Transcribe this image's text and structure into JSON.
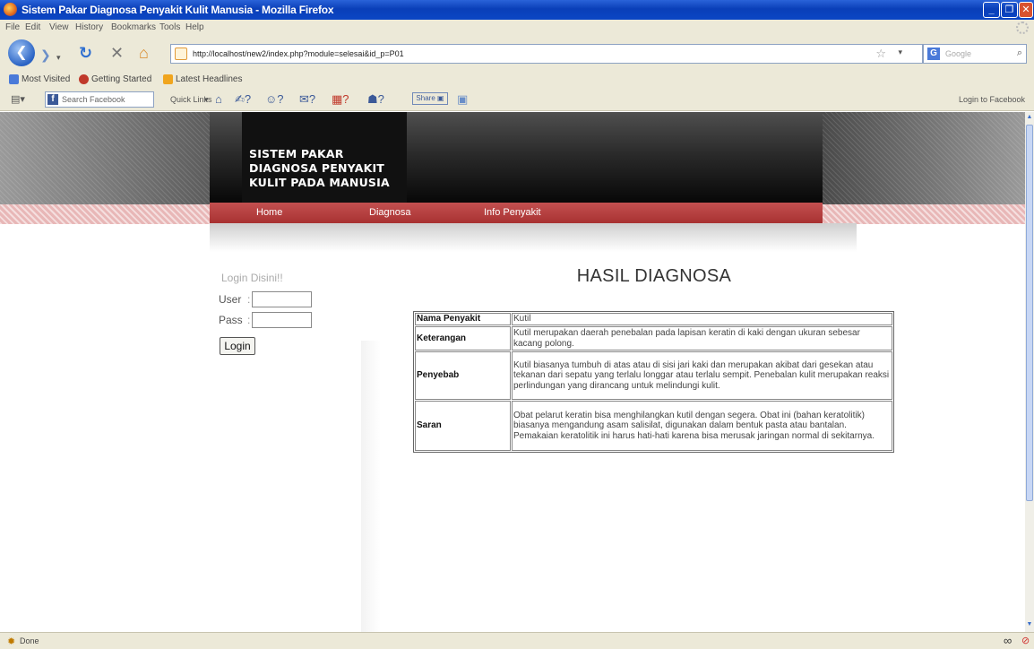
{
  "window": {
    "title": "Sistem Pakar Diagnosa Penyakit Kulit Manusia - Mozilla Firefox"
  },
  "menubar": {
    "items": [
      "File",
      "Edit",
      "View",
      "History",
      "Bookmarks",
      "Tools",
      "Help"
    ]
  },
  "navbar": {
    "url": "http://localhost/new2/index.php?module=selesai&id_p=P01",
    "search_placeholder": "Google"
  },
  "bookmarks": {
    "items": [
      "Most Visited",
      "Getting Started",
      "Latest Headlines"
    ]
  },
  "fbbar": {
    "search_placeholder": "Search Facebook",
    "quick_links": "Quick Links",
    "share_label": "Share",
    "login_link": "Login to Facebook"
  },
  "site": {
    "logo_lines": [
      "SISTEM PAKAR",
      "DIAGNOSA PENYAKIT",
      "KULIT PADA MANUSIA"
    ],
    "nav": [
      "Home",
      "Diagnosa",
      "Info Penyakit"
    ]
  },
  "login": {
    "heading": "Login Disini!!",
    "user_label": "User",
    "pass_label": "Pass",
    "separator": ":",
    "button_label": "Login"
  },
  "result": {
    "title": "HASIL DIAGNOSA",
    "rows": [
      {
        "key": "Nama Penyakit",
        "value": "Kutil"
      },
      {
        "key": "Keterangan",
        "value": "Kutil merupakan daerah penebalan pada lapisan keratin di kaki dengan ukuran sebesar kacang polong."
      },
      {
        "key": "Penyebab",
        "value": "Kutil biasanya tumbuh di atas atau di sisi jari kaki dan merupakan akibat dari gesekan atau tekanan dari sepatu yang terlalu longgar atau terlalu sempit. Penebalan kulit merupakan reaksi perlindungan yang dirancang untuk melindungi kulit."
      },
      {
        "key": "Saran",
        "value": "Obat pelarut keratin bisa menghilangkan kutil dengan segera. Obat ini (bahan keratolitik) biasanya mengandung asam salisilat, digunakan dalam bentuk pasta atau bantalan. Pemakaian keratolitik ini harus hati-hati karena bisa merusak jaringan normal di sekitarnya."
      }
    ]
  },
  "statusbar": {
    "text": "Done"
  }
}
